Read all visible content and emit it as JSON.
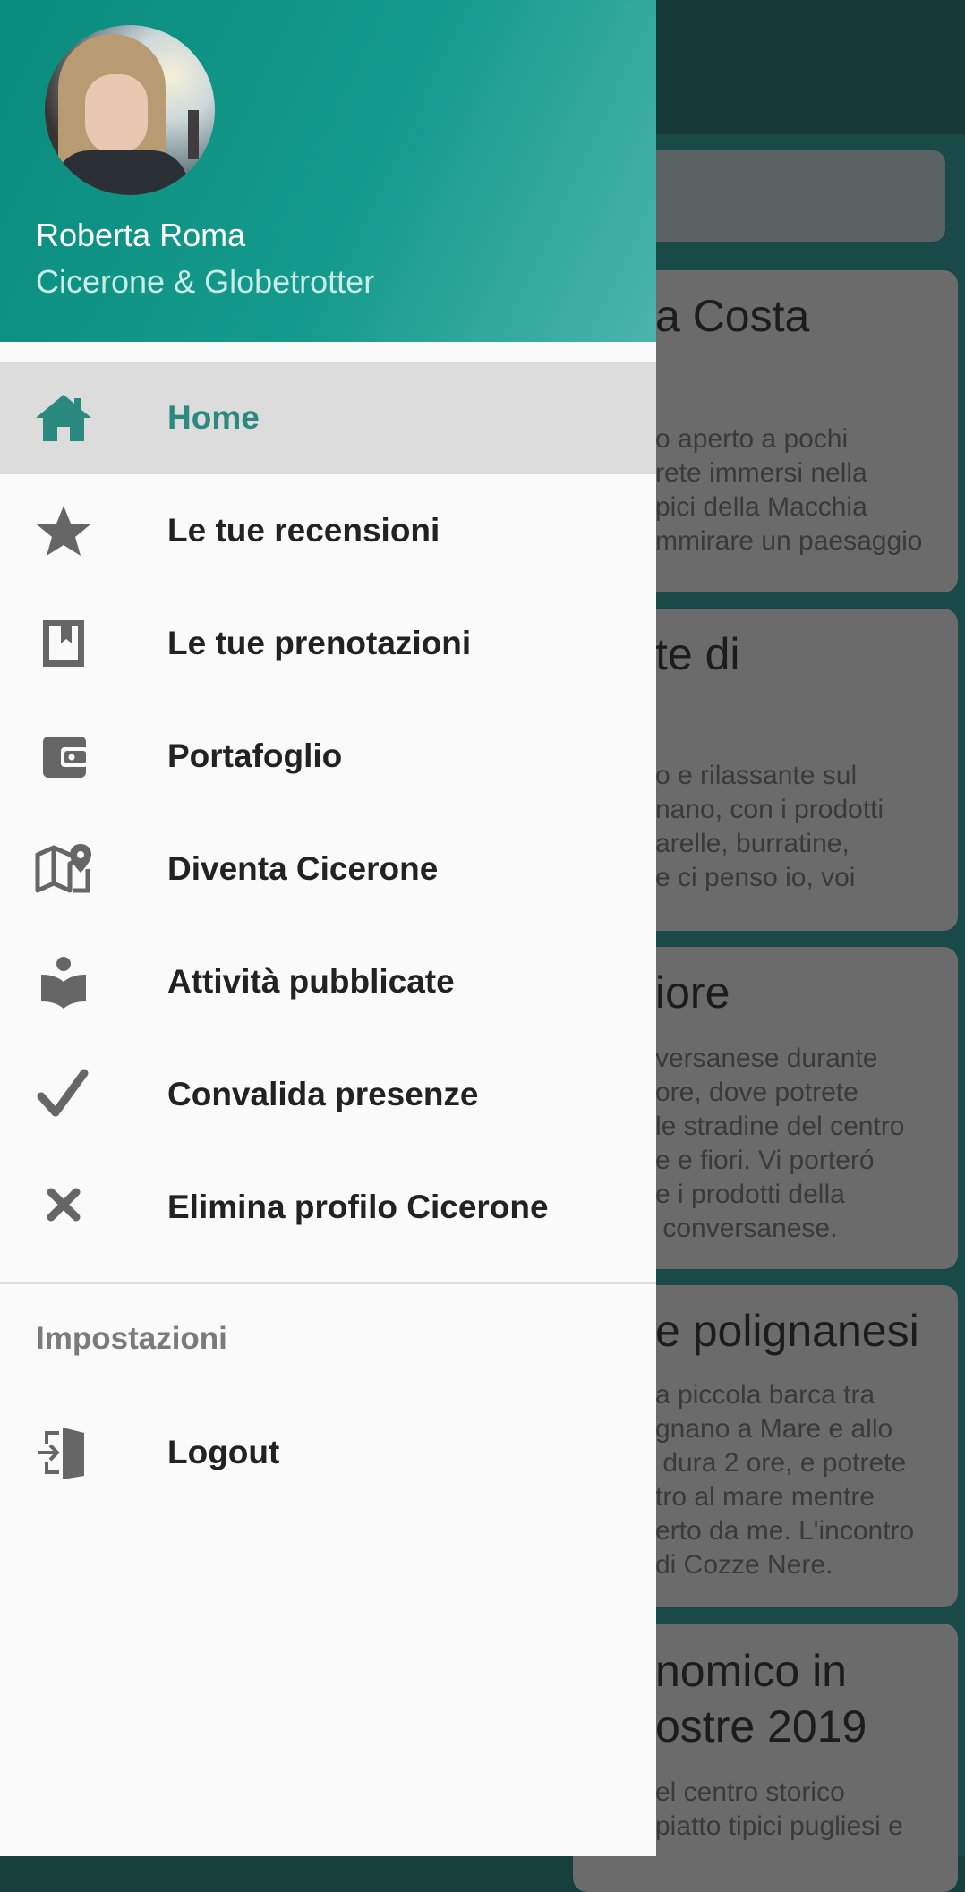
{
  "drawer": {
    "user": {
      "name": "Roberta Roma",
      "role": "Cicerone & Globetrotter"
    },
    "menu": [
      {
        "label": "Home",
        "icon": "home-icon",
        "active": true
      },
      {
        "label": "Le tue recensioni",
        "icon": "star-icon"
      },
      {
        "label": "Le tue prenotazioni",
        "icon": "bookmark-icon"
      },
      {
        "label": "Portafoglio",
        "icon": "wallet-icon"
      },
      {
        "label": "Diventa Cicerone",
        "icon": "map-icon"
      },
      {
        "label": "Attività pubblicate",
        "icon": "reader-icon"
      },
      {
        "label": "Convalida presenze",
        "icon": "check-icon"
      },
      {
        "label": "Elimina profilo Cicerone",
        "icon": "close-icon"
      }
    ],
    "settings": {
      "title": "Impostazioni",
      "items": [
        {
          "label": "Logout",
          "icon": "logout-icon"
        }
      ]
    }
  },
  "background_cards": [
    {
      "title": "a Costa",
      "body": "o aperto a pochi\nrete immersi nella\npici della Macchia\nmmirare un paesaggio"
    },
    {
      "title": "te di",
      "body": "o e rilassante sul\nnano, con i prodotti\narelle, burratine,\ne ci penso io, voi"
    },
    {
      "title": "iore",
      "body": "versanese durante\nore, dove potrete\nle stradine del centro\ne e fiori. Vi porteró\ne i prodotti della\n conversanese."
    },
    {
      "title": "e polignanesi",
      "body": "a piccola barca tra\ngnano a Mare e allo\n dura 2 ore, e potrete\ntro al mare mentre\nerto da me. L'incontro\ndi Cozze Nere."
    },
    {
      "title": "nomico in\nostre 2019",
      "body": "el centro storico\npiatto tipici pugliesi e"
    }
  ],
  "colors": {
    "accent": "#2b8a80",
    "header_start": "#0a8c7e",
    "header_end": "#4bb5aa"
  }
}
